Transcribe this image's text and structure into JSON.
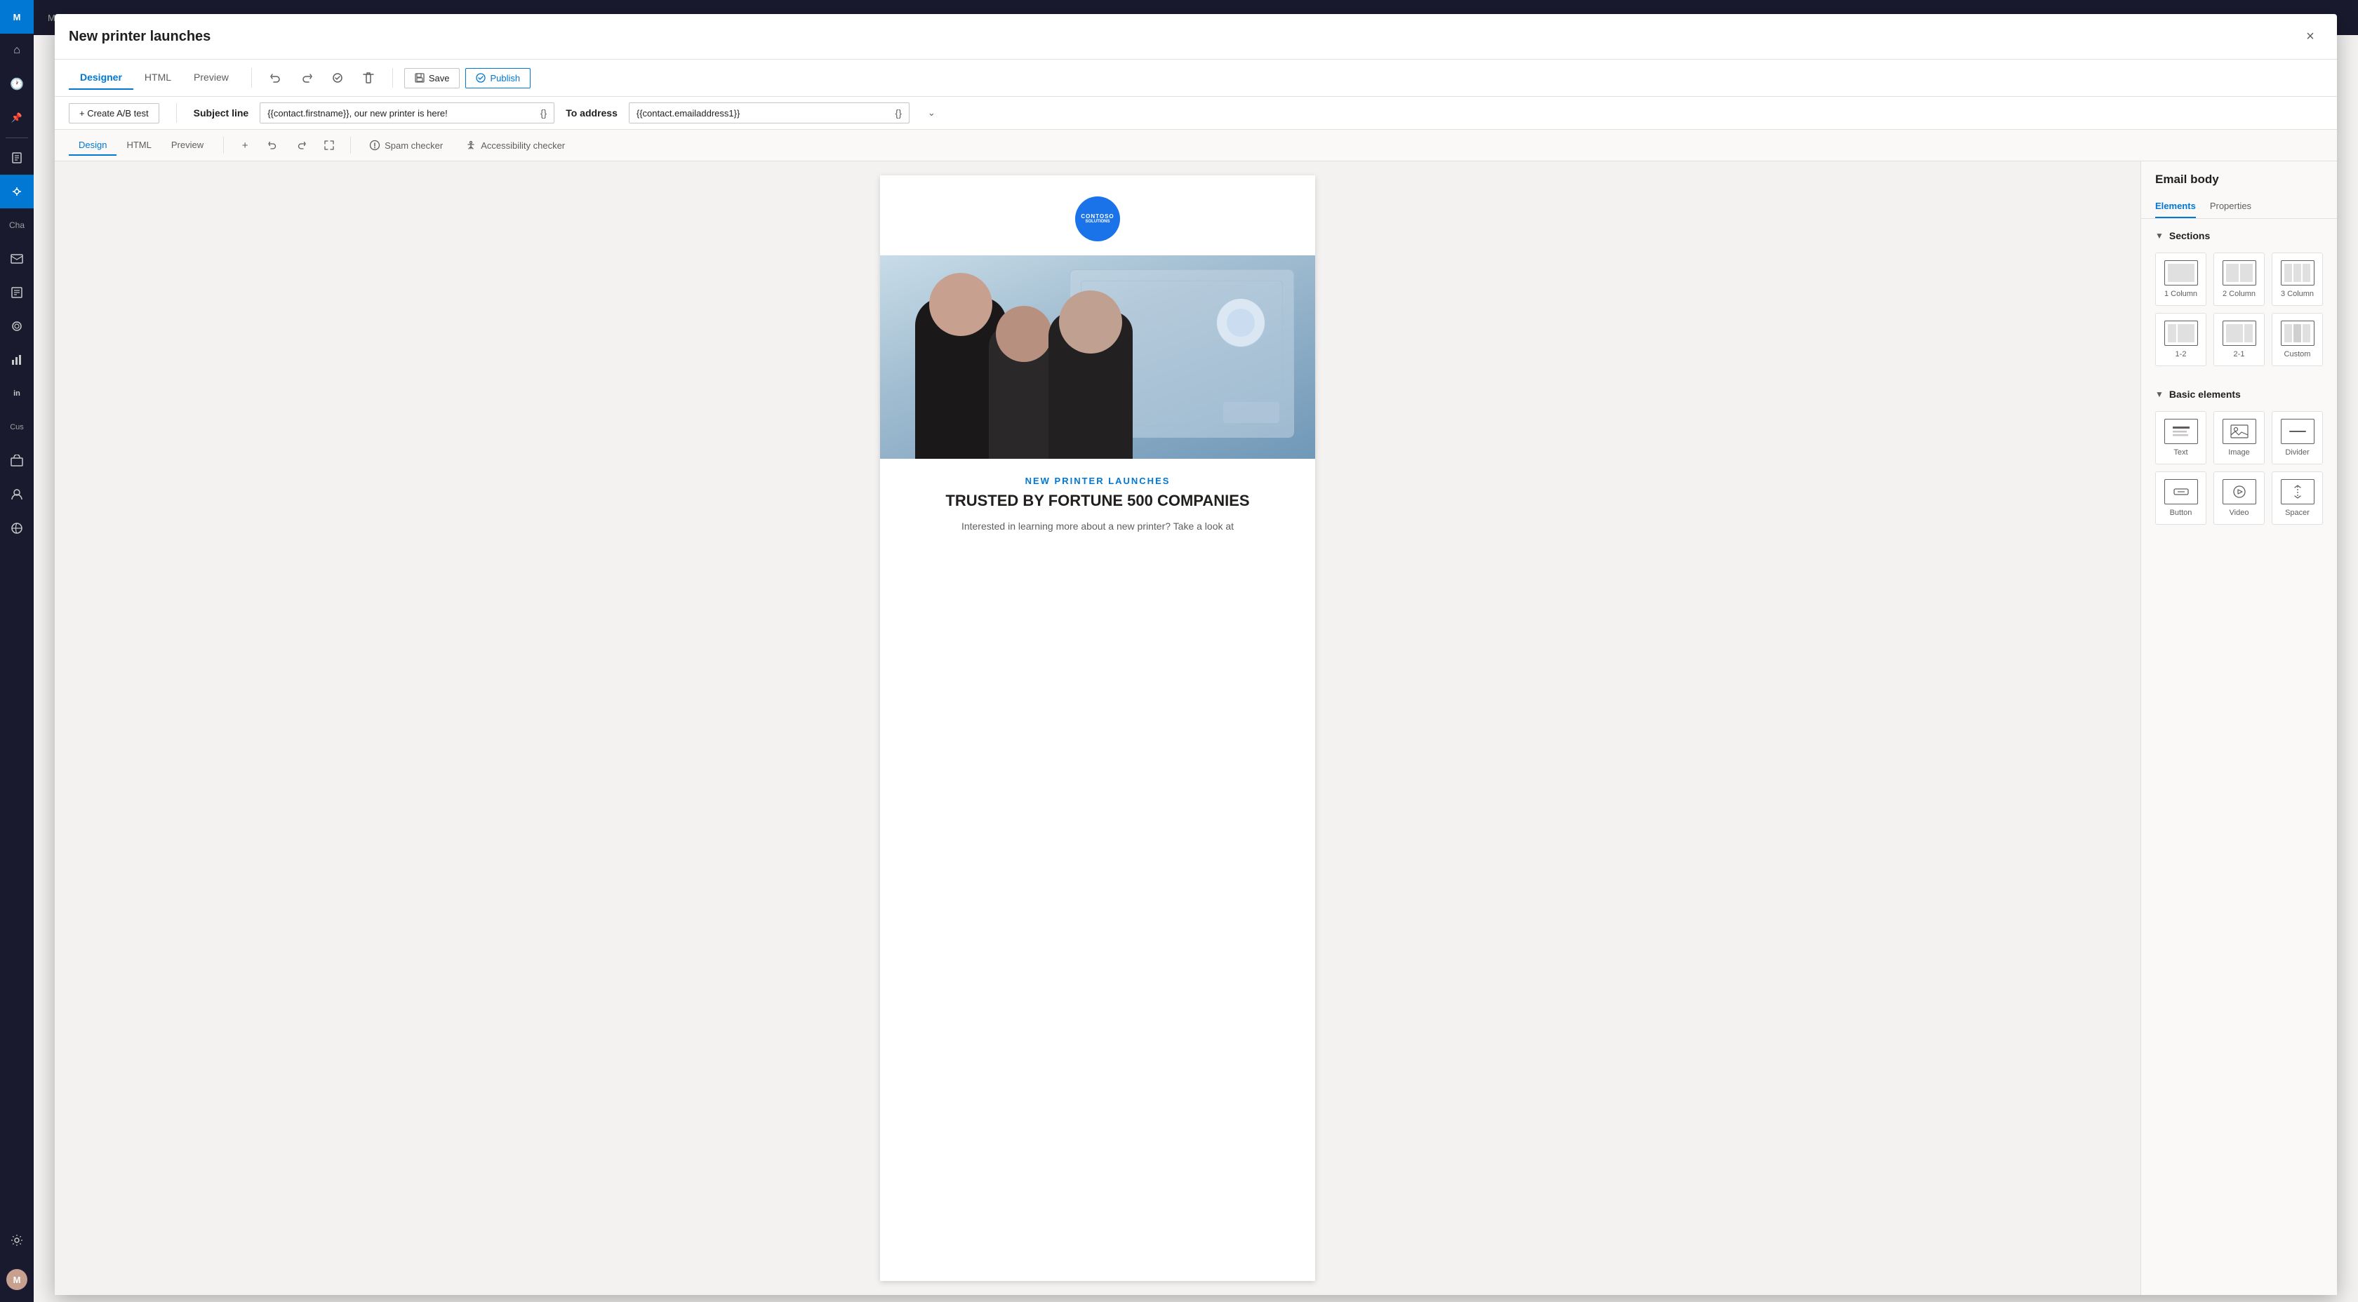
{
  "app": {
    "title": "New printer launches",
    "close_label": "×"
  },
  "toolbar": {
    "tabs": [
      {
        "id": "designer",
        "label": "Designer",
        "active": true
      },
      {
        "id": "html",
        "label": "HTML",
        "active": false
      },
      {
        "id": "preview",
        "label": "Preview",
        "active": false
      }
    ],
    "undo_label": "↩",
    "redo_label": "↪",
    "ai_label": "⟳",
    "delete_label": "🗑",
    "save_label": "Save",
    "publish_label": "Publish"
  },
  "subject": {
    "create_ab_label": "+ Create A/B test",
    "subject_line_label": "Subject line",
    "subject_value": "{{contact.firstname}}, our new printer is here!",
    "subject_icon": "{}",
    "to_label": "To address",
    "to_value": "{{contact.emailaddress1}}",
    "to_icon": "{}",
    "expand_icon": "⌄"
  },
  "design_toolbar": {
    "tabs": [
      {
        "id": "design",
        "label": "Design",
        "active": true
      },
      {
        "id": "html",
        "label": "HTML",
        "active": false
      },
      {
        "id": "preview",
        "label": "Preview",
        "active": false
      }
    ],
    "add_label": "+",
    "undo_label": "↩",
    "redo_label": "↪",
    "expand_label": "⤢",
    "spam_checker_label": "Spam checker",
    "accessibility_checker_label": "Accessibility checker"
  },
  "email": {
    "logo_text": "Contoso",
    "logo_subtext": "Solutions",
    "subheading": "NEW PRINTER LAUNCHES",
    "heading": "TRUSTED BY FORTUNE 500 COMPANIES",
    "body_text": "Interested in learning more about a new printer? Take a look at"
  },
  "right_panel": {
    "title": "Email body",
    "tabs": [
      {
        "id": "elements",
        "label": "Elements",
        "active": true
      },
      {
        "id": "properties",
        "label": "Properties",
        "active": false
      }
    ],
    "sections_header": "Sections",
    "sections": [
      {
        "id": "1col",
        "label": "1 Column"
      },
      {
        "id": "2col",
        "label": "2 Column"
      },
      {
        "id": "3col",
        "label": "3 Column"
      },
      {
        "id": "1-2",
        "label": "1-2"
      },
      {
        "id": "2-1",
        "label": "2-1"
      },
      {
        "id": "custom",
        "label": "Custom"
      }
    ],
    "basic_elements_header": "Basic elements",
    "basic_elements": [
      {
        "id": "text",
        "label": "Text"
      },
      {
        "id": "image",
        "label": "Image"
      },
      {
        "id": "divider",
        "label": "Divider"
      },
      {
        "id": "button",
        "label": "Button"
      },
      {
        "id": "video",
        "label": "Video"
      },
      {
        "id": "spacer",
        "label": "Spacer"
      }
    ]
  },
  "sidebar": {
    "items": [
      {
        "id": "home",
        "icon": "⌂",
        "label": "Home"
      },
      {
        "id": "recent",
        "icon": "🕐",
        "label": "Recent"
      },
      {
        "id": "pin",
        "icon": "📌",
        "label": "Pinned"
      },
      {
        "id": "contacts",
        "icon": "👥",
        "label": "Contacts"
      },
      {
        "id": "journeys",
        "icon": "⚡",
        "label": "Journeys",
        "active": true
      },
      {
        "id": "channels",
        "icon": "📧",
        "label": "Channels"
      },
      {
        "id": "forms",
        "icon": "📋",
        "label": "Forms"
      },
      {
        "id": "segments",
        "icon": "🎯",
        "label": "Segments"
      },
      {
        "id": "insights",
        "icon": "📊",
        "label": "Insights"
      },
      {
        "id": "linkedin",
        "icon": "in",
        "label": "LinkedIn"
      },
      {
        "id": "custom",
        "icon": "◈",
        "label": "Custom"
      },
      {
        "id": "assets",
        "icon": "🖼",
        "label": "Assets"
      },
      {
        "id": "websites",
        "icon": "🌐",
        "label": "Websites"
      }
    ]
  }
}
